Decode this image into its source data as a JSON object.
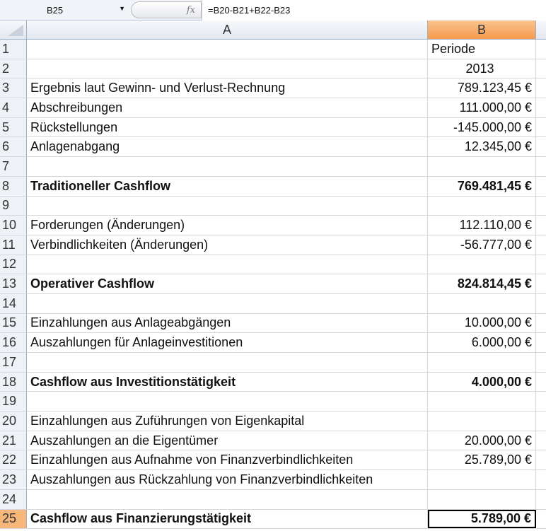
{
  "formula_bar": {
    "name_box": "B25",
    "fx": "fx",
    "formula": "=B20-B21+B22-B23"
  },
  "columns": [
    "A",
    "B"
  ],
  "selected_column": "B",
  "selected_row": "25",
  "rows": [
    {
      "n": "1",
      "a": "",
      "b": "Periode",
      "bold": false,
      "align": "left"
    },
    {
      "n": "2",
      "a": "",
      "b": "2013",
      "bold": false,
      "align": "center"
    },
    {
      "n": "3",
      "a": "Ergebnis laut Gewinn- und Verlust-Rechnung",
      "b": "789.123,45 €",
      "bold": false
    },
    {
      "n": "4",
      "a": "Abschreibungen",
      "b": "111.000,00 €",
      "bold": false
    },
    {
      "n": "5",
      "a": "Rückstellungen",
      "b": "-145.000,00 €",
      "bold": false
    },
    {
      "n": "6",
      "a": "Anlagenabgang",
      "b": "12.345,00 €",
      "bold": false
    },
    {
      "n": "7",
      "a": "",
      "b": "",
      "bold": false
    },
    {
      "n": "8",
      "a": "Traditioneller Cashflow",
      "b": "769.481,45 €",
      "bold": true
    },
    {
      "n": "9",
      "a": "",
      "b": "",
      "bold": false
    },
    {
      "n": "10",
      "a": "Forderungen (Änderungen)",
      "b": "112.110,00 €",
      "bold": false
    },
    {
      "n": "11",
      "a": "Verbindlichkeiten (Änderungen)",
      "b": "-56.777,00 €",
      "bold": false
    },
    {
      "n": "12",
      "a": "",
      "b": "",
      "bold": false
    },
    {
      "n": "13",
      "a": "Operativer Cashflow",
      "b": "824.814,45 €",
      "bold": true
    },
    {
      "n": "14",
      "a": "",
      "b": "",
      "bold": false
    },
    {
      "n": "15",
      "a": "Einzahlungen aus Anlageabgängen",
      "b": "10.000,00 €",
      "bold": false
    },
    {
      "n": "16",
      "a": "Auszahlungen für Anlageinvestitionen",
      "b": "6.000,00 €",
      "bold": false
    },
    {
      "n": "17",
      "a": "",
      "b": "",
      "bold": false
    },
    {
      "n": "18",
      "a": "Cashflow aus Investitionstätigkeit",
      "b": "4.000,00 €",
      "bold": true
    },
    {
      "n": "19",
      "a": "",
      "b": "",
      "bold": false
    },
    {
      "n": "20",
      "a": "Einzahlungen aus Zuführungen von Eigenkapital",
      "b": "",
      "bold": false
    },
    {
      "n": "21",
      "a": "Auszahlungen an die Eigentümer",
      "b": "20.000,00 €",
      "bold": false
    },
    {
      "n": "22",
      "a": "Einzahlungen aus Aufnahme von Finanzverbindlichkeiten",
      "b": "25.789,00 €",
      "bold": false
    },
    {
      "n": "23",
      "a": "Auszahlungen aus Rückzahlung von Finanzverbindlichkeiten",
      "b": "",
      "bold": false
    },
    {
      "n": "24",
      "a": "",
      "b": "",
      "bold": false
    },
    {
      "n": "25",
      "a": "Cashflow aus Finanzierungstätigkeit",
      "b": "5.789,00 €",
      "bold": true
    }
  ]
}
